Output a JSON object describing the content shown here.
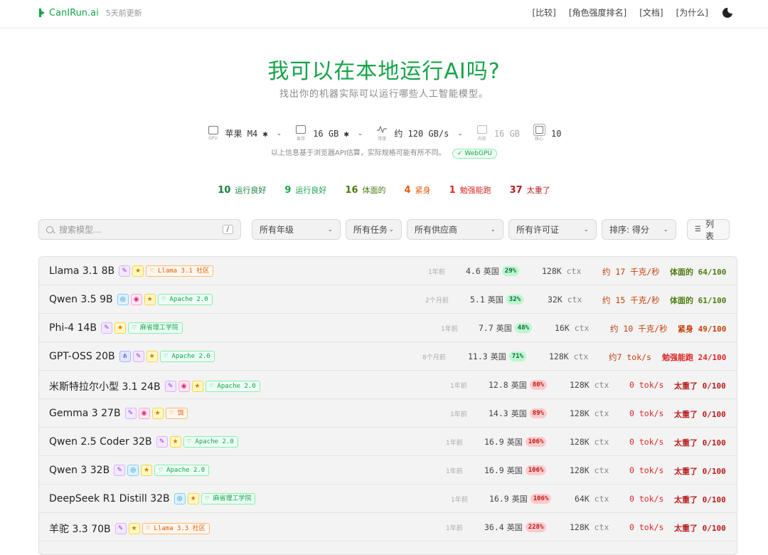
{
  "header": {
    "brand": "CanIRun.ai",
    "updated": "5天前更新",
    "nav": [
      "[比较]",
      "[角色强度排名]",
      "[文档]",
      "[为什么]"
    ]
  },
  "hero": {
    "title": "我可以在本地运行AI吗?",
    "subtitle": "找出你的机器实际可以运行哪些人工智能模型。"
  },
  "specs": {
    "gpu": {
      "caption": "GPU",
      "value": "苹果 M4 ✱"
    },
    "vram": {
      "caption": "显存",
      "value": "16 GB ✱"
    },
    "bandwidth": {
      "caption": "带宽",
      "value": "约 120 GB/s"
    },
    "ram": {
      "caption": "内存",
      "value": "16 GB"
    },
    "cores": {
      "caption": "核心",
      "value": "10"
    },
    "note": "以上信息基于浏览器API估算，实际规格可能有所不同。",
    "webgpu": "✓ WebGPU"
  },
  "counts": [
    {
      "num": "10",
      "label": "运行良好",
      "color": "#15803d"
    },
    {
      "num": "9",
      "label": "运行良好",
      "color": "#16a34a"
    },
    {
      "num": "16",
      "label": "体面的",
      "color": "#4d7c0f"
    },
    {
      "num": "4",
      "label": "紧身",
      "color": "#ea580c"
    },
    {
      "num": "1",
      "label": "勉强能跑",
      "color": "#dc2626"
    },
    {
      "num": "37",
      "label": "太重了",
      "color": "#b91c1c"
    }
  ],
  "filters": {
    "search_placeholder": "搜索模型...",
    "search_key": "/",
    "tier": "所有年级",
    "task": "所有任务",
    "vendor": "所有供应商",
    "license": "所有许可证",
    "sort": "排序: 得分",
    "view": "列表"
  },
  "models": [
    {
      "name": "Llama 3.1 8B",
      "badges": [
        "purple",
        "yellow"
      ],
      "license": "Llama 3.1 社区",
      "lic_color": "orange",
      "age": "1年前",
      "size": "4.6",
      "unit": "英国",
      "pct": "29%",
      "pct_color": "g",
      "ctx": "128K",
      "speed": "约 17 千克/秒",
      "speed_color": "#c2410c",
      "verdict": "体面的 64/100",
      "verdict_color": "#4d7c0f"
    },
    {
      "name": "Qwen 3.5 9B",
      "badges": [
        "blue",
        "pink",
        "yellow"
      ],
      "license": "Apache 2.0",
      "lic_color": "green",
      "age": "2个月前",
      "size": "5.1",
      "unit": "英国",
      "pct": "32%",
      "pct_color": "g",
      "ctx": "32K",
      "speed": "约 15 千克/秒",
      "speed_color": "#c2410c",
      "verdict": "体面的 61/100",
      "verdict_color": "#4d7c0f"
    },
    {
      "name": "Phi-4 14B",
      "badges": [
        "purple",
        "yellow"
      ],
      "license": "麻省理工学院",
      "lic_color": "green",
      "age": "1年前",
      "size": "7.7",
      "unit": "英国",
      "pct": "48%",
      "pct_color": "g",
      "ctx": "16K",
      "speed": "约 10 千克/秒",
      "speed_color": "#c2410c",
      "verdict": "紧身 49/100",
      "verdict_color": "#c2410c"
    },
    {
      "name": "GPT-OSS 20B",
      "badges": [
        "indigo",
        "purple",
        "yellow"
      ],
      "license": "Apache 2.0",
      "lic_color": "green",
      "age": "8个月前",
      "size": "11.3",
      "unit": "英国",
      "pct": "71%",
      "pct_color": "g",
      "ctx": "128K",
      "speed": "约7 tok/s",
      "speed_color": "#c2410c",
      "verdict": "勉强能跑 24/100",
      "verdict_color": "#dc2626"
    },
    {
      "name": "米斯特拉尔小型 3.1 24B",
      "badges": [
        "purple",
        "pink",
        "yellow"
      ],
      "license": "Apache 2.0",
      "lic_color": "green",
      "age": "1年前",
      "size": "12.8",
      "unit": "英国",
      "pct": "80%",
      "pct_color": "r",
      "ctx": "128K",
      "speed": "0 tok/s",
      "speed_color": "#dc2626",
      "verdict": "太重了 0/100",
      "verdict_color": "#b91c1c"
    },
    {
      "name": "Gemma 3 27B",
      "badges": [
        "purple",
        "pink",
        "yellow"
      ],
      "license": "饵",
      "lic_color": "orange",
      "age": "1年前",
      "size": "14.3",
      "unit": "英国",
      "pct": "89%",
      "pct_color": "r",
      "ctx": "128K",
      "speed": "0 tok/s",
      "speed_color": "#dc2626",
      "verdict": "太重了 0/100",
      "verdict_color": "#b91c1c"
    },
    {
      "name": "Qwen 2.5 Coder 32B",
      "badges": [
        "purple",
        "yellow"
      ],
      "license": "Apache 2.0",
      "lic_color": "green",
      "age": "1年前",
      "size": "16.9",
      "unit": "英国",
      "pct": "106%",
      "pct_color": "r",
      "ctx": "128K",
      "speed": "0 tok/s",
      "speed_color": "#dc2626",
      "verdict": "太重了 0/100",
      "verdict_color": "#b91c1c"
    },
    {
      "name": "Qwen 3 32B",
      "badges": [
        "purple",
        "blue",
        "yellow"
      ],
      "license": "Apache 2.0",
      "lic_color": "green",
      "age": "1年前",
      "size": "16.9",
      "unit": "英国",
      "pct": "106%",
      "pct_color": "r",
      "ctx": "128K",
      "speed": "0 tok/s",
      "speed_color": "#dc2626",
      "verdict": "太重了 0/100",
      "verdict_color": "#b91c1c"
    },
    {
      "name": "DeepSeek R1 Distill 32B",
      "badges": [
        "blue",
        "yellow"
      ],
      "license": "麻省理工学院",
      "lic_color": "green",
      "age": "1年前",
      "size": "16.9",
      "unit": "英国",
      "pct": "106%",
      "pct_color": "r",
      "ctx": "64K",
      "speed": "0 tok/s",
      "speed_color": "#dc2626",
      "verdict": "太重了 0/100",
      "verdict_color": "#b91c1c"
    },
    {
      "name": "羊驼 3.3 70B",
      "badges": [
        "purple",
        "yellow"
      ],
      "license": "Llama 3.3 社区",
      "lic_color": "orange",
      "age": "1年前",
      "size": "36.4",
      "unit": "英国",
      "pct": "228%",
      "pct_color": "r",
      "ctx": "128K",
      "speed": "0 tok/s",
      "speed_color": "#dc2626",
      "verdict": "太重了 0/100",
      "verdict_color": "#b91c1c"
    }
  ]
}
